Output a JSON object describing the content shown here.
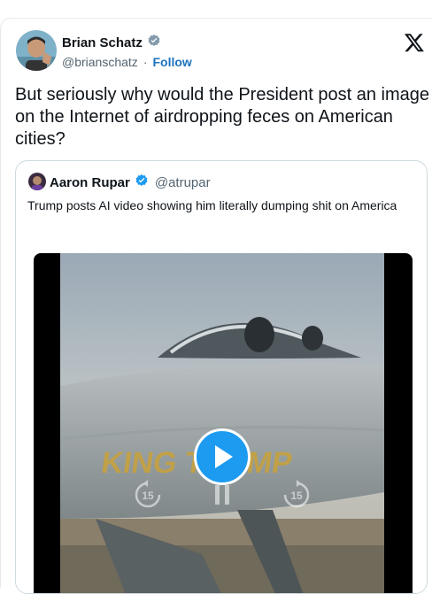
{
  "author": {
    "name": "Brian Schatz",
    "handle": "@brianschatz",
    "separator": "·",
    "follow_label": "Follow",
    "verified_icon": "verified-badge-icon"
  },
  "tweet": {
    "text": "But seriously why would the President post an image on the Internet of airdropping feces on American cities?"
  },
  "quoted": {
    "name": "Aaron Rupar",
    "handle": "@atrupar",
    "text": "Trump posts AI video showing him literally dumping shit on America",
    "video": {
      "fuselage_text": "KING TRUMP",
      "rewind_label": "15",
      "forward_label": "15"
    }
  },
  "colors": {
    "accent": "#1d9bf0",
    "follow": "#1d73be",
    "text": "#0f1419",
    "muted": "#536471"
  }
}
